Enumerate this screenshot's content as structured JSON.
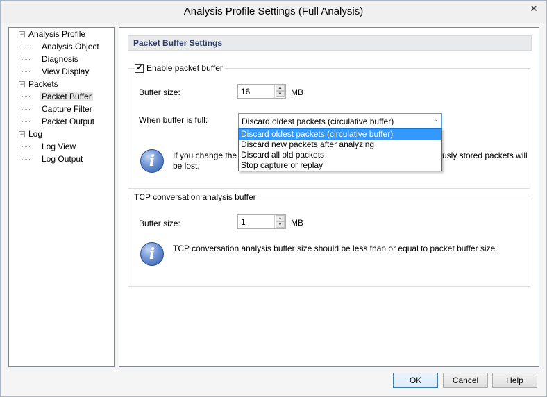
{
  "window": {
    "title": "Analysis Profile Settings (Full Analysis)",
    "close_symbol": "✕"
  },
  "tree": {
    "items": [
      {
        "label": "Analysis Profile"
      },
      {
        "label": "Analysis Object"
      },
      {
        "label": "Diagnosis"
      },
      {
        "label": "View Display"
      },
      {
        "label": "Packets"
      },
      {
        "label": "Packet Buffer"
      },
      {
        "label": "Capture Filter"
      },
      {
        "label": "Packet Output"
      },
      {
        "label": "Log"
      },
      {
        "label": "Log View"
      },
      {
        "label": "Log Output"
      }
    ],
    "expander_symbol": "−"
  },
  "packet_buffer": {
    "header": "Packet Buffer Settings",
    "enable_label": "Enable packet buffer",
    "enabled_mark": "✔",
    "buffer_size_label": "Buffer size:",
    "buffer_size_value": "16",
    "buffer_size_unit": "MB",
    "when_full_label": "When buffer is full:",
    "when_full_selected": "Discard oldest packets (circulative buffer)",
    "when_full_options": [
      "Discard oldest packets (circulative buffer)",
      "Discard new packets after analyzing",
      "Discard all old packets",
      "Stop capture or replay"
    ],
    "info_line1_a": "If you change the",
    "info_line1_b": "usly stored packets will",
    "info_line2": "be lost."
  },
  "tcp": {
    "title": "TCP conversation analysis buffer",
    "buffer_size_label": "Buffer size:",
    "buffer_size_value": "1",
    "buffer_size_unit": "MB",
    "info": "TCP conversation analysis buffer size should be less than or equal to packet buffer size."
  },
  "icons": {
    "info_glyph": "i",
    "spin_up": "▲",
    "spin_down": "▼",
    "combo_arrow": "⌄"
  },
  "buttons": {
    "ok": "OK",
    "cancel": "Cancel",
    "help": "Help"
  }
}
